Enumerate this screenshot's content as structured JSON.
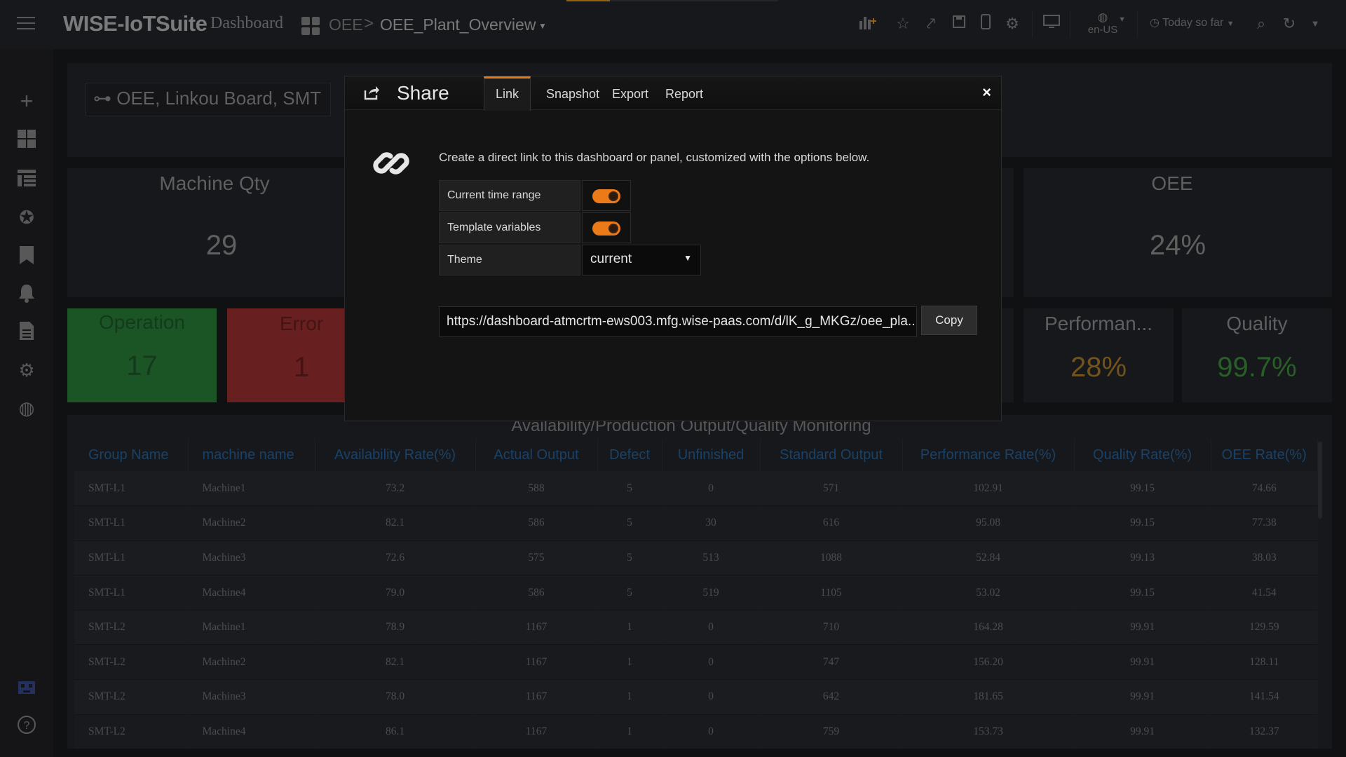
{
  "app": {
    "brand": "WISE-IoTSuite",
    "section": "Dashboard",
    "folder": "OEE",
    "separator": ">",
    "page": "OEE_Plant_Overview",
    "language": "en-US",
    "time_range": "Today so far"
  },
  "dashboard": {
    "filter_label": "OEE, Linkou Board, SMT",
    "machine_qty": {
      "title": "Machine Qty",
      "value": "29"
    },
    "oee": {
      "title": "OEE",
      "value": "24%"
    },
    "operation": {
      "title": "Operation",
      "value": "17"
    },
    "error": {
      "title": "Error",
      "value": "1"
    },
    "performance": {
      "title": "Performan...",
      "value": "28%"
    },
    "quality": {
      "title": "Quality",
      "value": "99.7%"
    }
  },
  "table": {
    "title": "Availability/Production Output/Quality Monitoring",
    "columns": [
      "Group Name",
      "machine name",
      "Availability Rate(%)",
      "Actual Output",
      "Defect",
      "Unfinished",
      "Standard Output",
      "Performance Rate(%)",
      "Quality Rate(%)",
      "OEE Rate(%)"
    ],
    "rows": [
      [
        "SMT-L1",
        "Machine1",
        "73.2",
        "588",
        "5",
        "0",
        "571",
        "102.91",
        "99.15",
        "74.66"
      ],
      [
        "SMT-L1",
        "Machine2",
        "82.1",
        "586",
        "5",
        "30",
        "616",
        "95.08",
        "99.15",
        "77.38"
      ],
      [
        "SMT-L1",
        "Machine3",
        "72.6",
        "575",
        "5",
        "513",
        "1088",
        "52.84",
        "99.13",
        "38.03"
      ],
      [
        "SMT-L1",
        "Machine4",
        "79.0",
        "586",
        "5",
        "519",
        "1105",
        "53.02",
        "99.15",
        "41.54"
      ],
      [
        "SMT-L2",
        "Machine1",
        "78.9",
        "1167",
        "1",
        "0",
        "710",
        "164.28",
        "99.91",
        "129.59"
      ],
      [
        "SMT-L2",
        "Machine2",
        "82.1",
        "1167",
        "1",
        "0",
        "747",
        "156.20",
        "99.91",
        "128.11"
      ],
      [
        "SMT-L2",
        "Machine3",
        "78.0",
        "1167",
        "1",
        "0",
        "642",
        "181.65",
        "99.91",
        "141.54"
      ],
      [
        "SMT-L2",
        "Machine4",
        "86.1",
        "1167",
        "1",
        "0",
        "759",
        "153.73",
        "99.91",
        "132.37"
      ]
    ]
  },
  "modal": {
    "title": "Share",
    "tabs": [
      "Link",
      "Snapshot",
      "Export",
      "Report"
    ],
    "close": "×",
    "description": "Create a direct link to this dashboard or panel, customized with the options below.",
    "options": {
      "time_range_label": "Current time range",
      "time_range_on": true,
      "template_vars_label": "Template variables",
      "template_vars_on": true,
      "theme_label": "Theme",
      "theme_value": "current"
    },
    "url": "https://dashboard-atmcrtm-ews003.mfg.wise-paas.com/d/lK_g_MKGz/oee_pla...",
    "copy_label": "Copy"
  },
  "colors": {
    "accent": "#eb7b18",
    "operation_green": "#2d8a3e",
    "error_red": "#a83232",
    "performance_text": "#b8862a",
    "quality_text": "#3f9a3f",
    "header_blue": "#2b6aa6"
  }
}
